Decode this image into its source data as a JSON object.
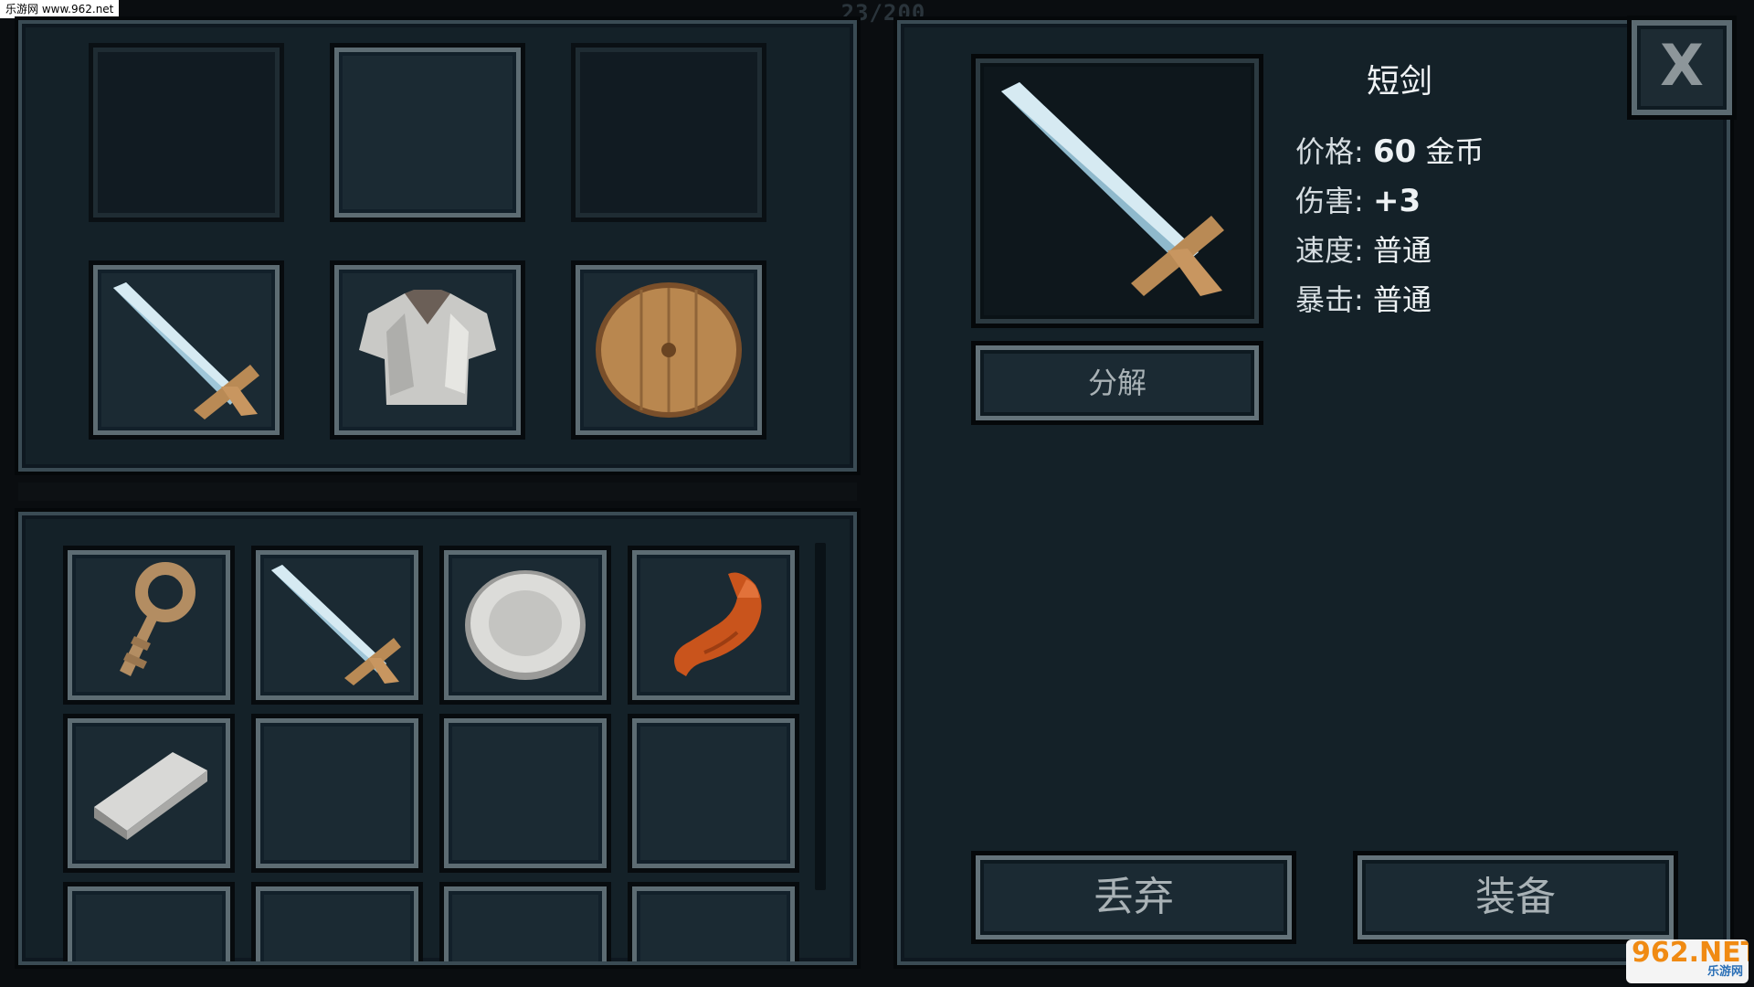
{
  "watermark_top": "乐游网 www.962.net",
  "top_counter": "23/200",
  "equipment": {
    "slots": [
      {
        "item": "",
        "icon": "empty-slot"
      },
      {
        "item": "",
        "icon": "empty-slot"
      },
      {
        "item": "",
        "icon": "empty-slot"
      },
      {
        "item": "short-sword",
        "icon": "sword-icon"
      },
      {
        "item": "cloth-armor",
        "icon": "armor-icon"
      },
      {
        "item": "wooden-shield",
        "icon": "shield-icon"
      }
    ]
  },
  "inventory": {
    "slots": [
      {
        "icon": "key-icon"
      },
      {
        "icon": "sword-icon"
      },
      {
        "icon": "silver-plate-icon"
      },
      {
        "icon": "crab-claw-icon"
      },
      {
        "icon": "iron-ingot-icon"
      },
      {
        "icon": "empty-slot"
      },
      {
        "icon": "empty-slot"
      },
      {
        "icon": "empty-slot"
      },
      {
        "icon": "empty-slot"
      },
      {
        "icon": "empty-slot"
      },
      {
        "icon": "empty-slot"
      },
      {
        "icon": "empty-slot"
      }
    ]
  },
  "detail": {
    "name": "短剑",
    "preview_icon": "sword-icon",
    "stats": {
      "price_label": "价格:",
      "price_value": "60",
      "price_unit": "金币",
      "damage_label": "伤害:",
      "damage_value": "+3",
      "speed_label": "速度:",
      "speed_value": "普通",
      "crit_label": "暴击:",
      "crit_value": "普通"
    },
    "decompose_label": "分解",
    "drop_label": "丢弃",
    "equip_label": "装备",
    "close_label": "X"
  },
  "watermark_bottom": {
    "main": "962.NET",
    "sub": "乐游网"
  },
  "colors": {
    "panel_bg": "#142128",
    "slot_bg": "#1b2a33",
    "slot_border": "#5d6c73",
    "text": "#e6ecef"
  }
}
